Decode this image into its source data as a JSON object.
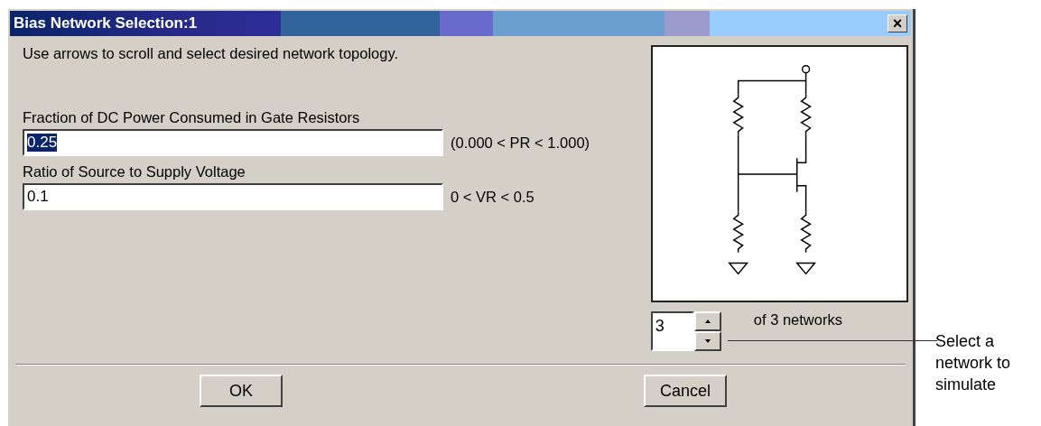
{
  "window": {
    "title": "Bias Network Selection:1",
    "close_label": "×"
  },
  "instruction": "Use arrows to scroll and select desired network topology.",
  "fields": [
    {
      "label": "Fraction of DC Power Consumed in Gate Resistors",
      "value": "0.25",
      "text_selected": true,
      "range": "(0.000 < PR < 1.000)"
    },
    {
      "label": "Ratio of Source to Supply Voltage",
      "value": "0.1",
      "text_selected": false,
      "range": "0 < VR < 0.5"
    }
  ],
  "network_spinner": {
    "value": "3",
    "count_text": "of 3 networks"
  },
  "buttons": [
    {
      "label": "OK"
    },
    {
      "label": "Cancel"
    }
  ],
  "callout": "Select a network to simulate"
}
